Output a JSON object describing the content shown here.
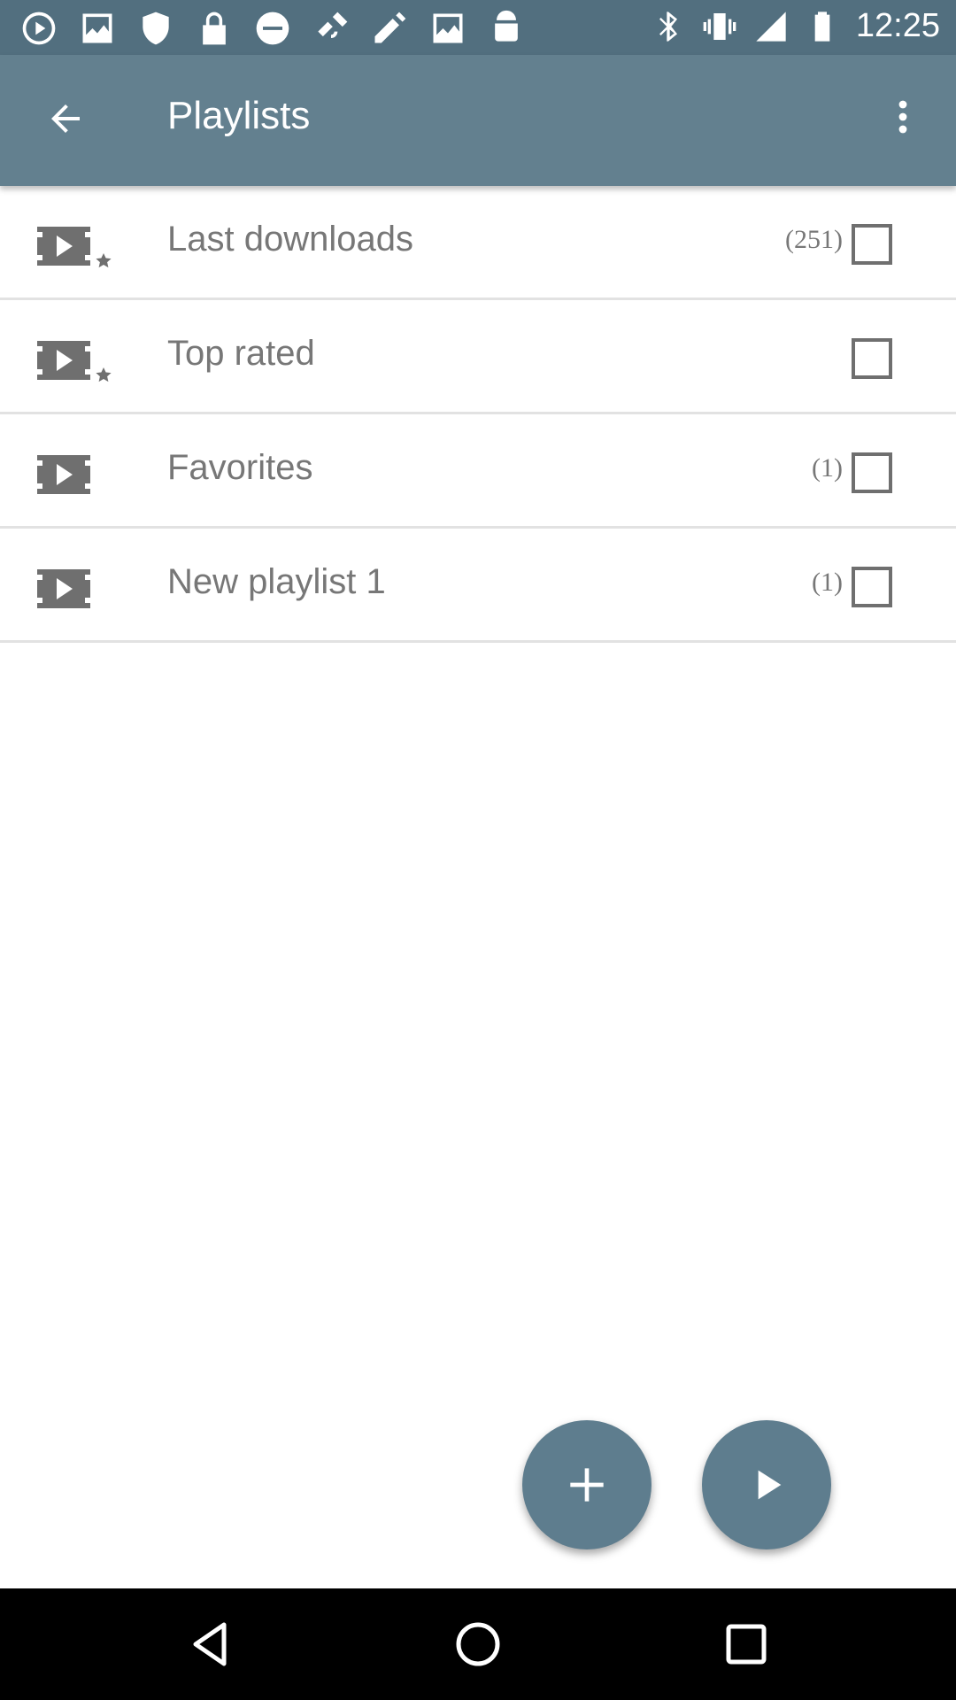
{
  "status_bar": {
    "time": "12:25",
    "left_icons": [
      "play-circle-icon",
      "image-icon",
      "shield-icon",
      "lock-icon",
      "block-icon",
      "satellite-fake-gps-icon",
      "edit-icon",
      "image-icon",
      "android-icon"
    ],
    "right_icons": [
      "bluetooth-icon",
      "vibrate-icon",
      "signal-icon",
      "battery-icon"
    ]
  },
  "app_bar": {
    "title": "Playlists",
    "back_icon": "arrow-back-icon",
    "menu_icon": "more-vert-icon"
  },
  "playlists": [
    {
      "label": "Last downloads",
      "count": "(251)",
      "icon": "video-star-icon",
      "checked": false
    },
    {
      "label": "Top rated",
      "count": "",
      "icon": "video-star-icon",
      "checked": false
    },
    {
      "label": "Favorites",
      "count": "(1)",
      "icon": "video-icon",
      "checked": false
    },
    {
      "label": "New playlist 1",
      "count": "(1)",
      "icon": "video-icon",
      "checked": false
    }
  ],
  "fabs": {
    "add_icon": "plus-icon",
    "play_icon": "play-icon"
  },
  "nav_bar": {
    "back_icon": "nav-back-icon",
    "home_icon": "nav-home-icon",
    "recents_icon": "nav-recents-icon"
  },
  "colors": {
    "status_bar": "#526f7f",
    "app_bar": "#63808f",
    "fab": "#5e7d8e",
    "text": "#777777",
    "divider": "#e2e2e2"
  }
}
